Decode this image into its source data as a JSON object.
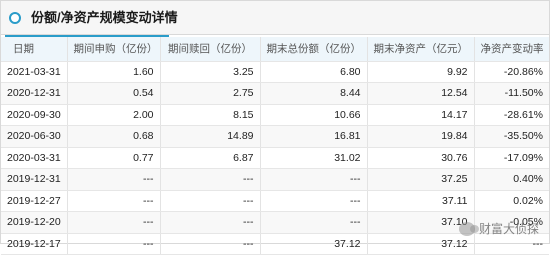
{
  "header": {
    "title": "份额/净资产规模变动详情"
  },
  "table": {
    "columns": [
      "日期",
      "期间申购（亿份）",
      "期间赎回（亿份）",
      "期末总份额（亿份）",
      "期末净资产（亿元）",
      "净资产变动率"
    ],
    "rows": [
      [
        "2021-03-31",
        "1.60",
        "3.25",
        "6.80",
        "9.92",
        "-20.86%"
      ],
      [
        "2020-12-31",
        "0.54",
        "2.75",
        "8.44",
        "12.54",
        "-11.50%"
      ],
      [
        "2020-09-30",
        "2.00",
        "8.15",
        "10.66",
        "14.17",
        "-28.61%"
      ],
      [
        "2020-06-30",
        "0.68",
        "14.89",
        "16.81",
        "19.84",
        "-35.50%"
      ],
      [
        "2020-03-31",
        "0.77",
        "6.87",
        "31.02",
        "30.76",
        "-17.09%"
      ],
      [
        "2019-12-31",
        "---",
        "---",
        "---",
        "37.25",
        "0.40%"
      ],
      [
        "2019-12-27",
        "---",
        "---",
        "---",
        "37.11",
        "0.02%"
      ],
      [
        "2019-12-20",
        "---",
        "---",
        "---",
        "37.10",
        "-0.05%"
      ],
      [
        "2019-12-17",
        "---",
        "---",
        "37.12",
        "37.12",
        "---"
      ]
    ]
  },
  "watermark": {
    "text": "财富大侦探"
  }
}
